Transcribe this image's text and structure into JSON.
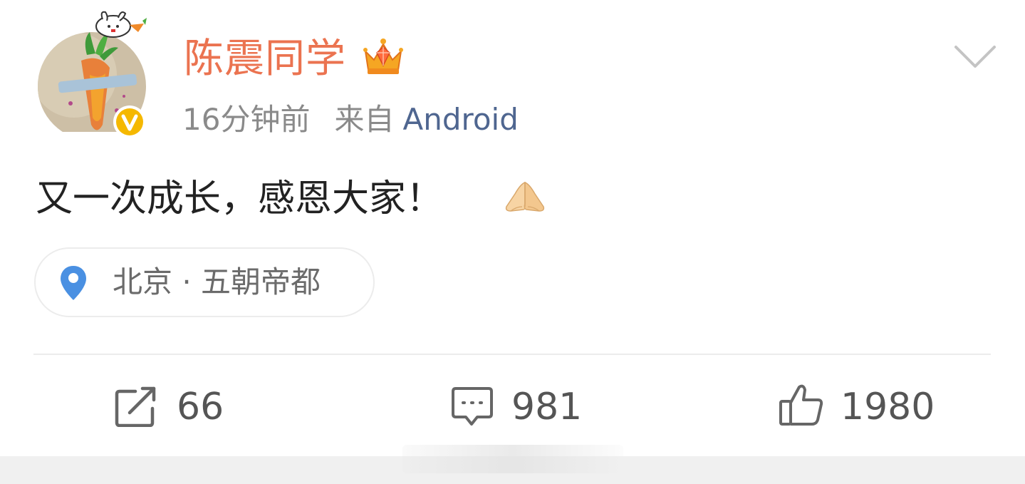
{
  "post": {
    "username": "陈震同学",
    "time": "16分钟前",
    "source_label": "来自",
    "source_name": "Android",
    "text": "又一次成长，感恩大家！",
    "location": "北京 · 五朝帝都"
  },
  "actions": {
    "repost_count": "66",
    "comment_count": "981",
    "like_count": "1980"
  },
  "icons": {
    "avatar": "avatar-carrot-tattoo",
    "verified": "verified-v-badge-icon",
    "crown": "crown-icon",
    "more": "chevron-down-icon",
    "emoji": "folded-hands-icon",
    "location": "location-pin-icon",
    "repost": "repost-icon",
    "comment": "comment-icon",
    "like": "thumbs-up-icon"
  },
  "colors": {
    "username": "#eb7350",
    "source_link": "#4f6690",
    "meta": "#8a8a8a",
    "text": "#222222",
    "location_pin": "#4a90e2",
    "verified_badge": "#f5b800"
  }
}
